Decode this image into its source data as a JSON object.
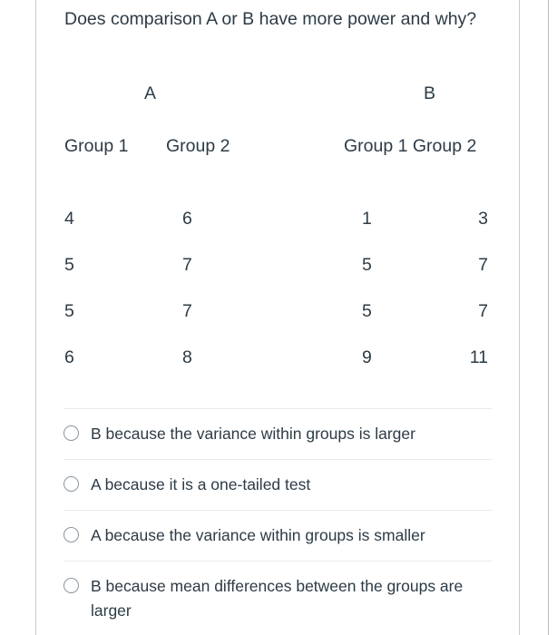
{
  "question": {
    "text": "Does comparison A or B have more power and why?"
  },
  "comparison_headers": {
    "a": "A",
    "b": "B"
  },
  "group_headers": {
    "a_group1": "Group 1",
    "a_group2": "Group 2",
    "b_group1": "Group 1",
    "b_group2": "Group 2"
  },
  "table": {
    "columns": [
      "Group 1",
      "Group 2",
      "Group 1",
      "Group 2"
    ],
    "rows": [
      [
        "4",
        "6",
        "1",
        "3"
      ],
      [
        "5",
        "7",
        "5",
        "7"
      ],
      [
        "5",
        "7",
        "5",
        "7"
      ],
      [
        "6",
        "8",
        "9",
        "11"
      ]
    ]
  },
  "answers": [
    {
      "label": "B because the variance within groups is larger",
      "selected": false
    },
    {
      "label": "A because it is a one-tailed test",
      "selected": false
    },
    {
      "label": "A because the variance within groups is smaller",
      "selected": false
    },
    {
      "label": "B because mean differences between the groups are larger",
      "selected": false
    }
  ],
  "colors": {
    "text": "#2d3b45",
    "divider": "#e8eaec",
    "border": "#c7cdd1",
    "radio_border": "#8b969e"
  }
}
